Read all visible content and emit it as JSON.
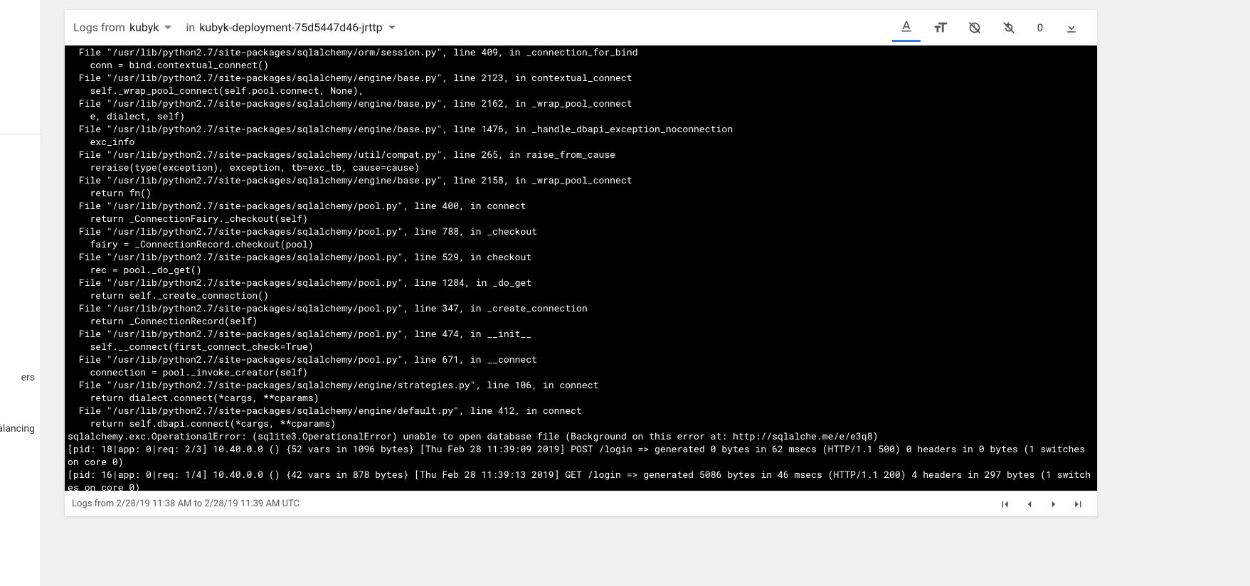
{
  "sidebar": {
    "items": [
      "ers",
      "alancing"
    ]
  },
  "header": {
    "selector1_label": "Logs from",
    "selector1_value": "kubyk",
    "selector2_label": "in",
    "selector2_value": "kubyk-deployment-75d5447d46-jrttp",
    "count": "0"
  },
  "log_lines": [
    "  File \"/usr/lib/python2.7/site-packages/sqlalchemy/orm/session.py\", line 409, in _connection_for_bind",
    "    conn = bind.contextual_connect()",
    "  File \"/usr/lib/python2.7/site-packages/sqlalchemy/engine/base.py\", line 2123, in contextual_connect",
    "    self._wrap_pool_connect(self.pool.connect, None),",
    "  File \"/usr/lib/python2.7/site-packages/sqlalchemy/engine/base.py\", line 2162, in _wrap_pool_connect",
    "    e, dialect, self)",
    "  File \"/usr/lib/python2.7/site-packages/sqlalchemy/engine/base.py\", line 1476, in _handle_dbapi_exception_noconnection",
    "    exc_info",
    "  File \"/usr/lib/python2.7/site-packages/sqlalchemy/util/compat.py\", line 265, in raise_from_cause",
    "    reraise(type(exception), exception, tb=exc_tb, cause=cause)",
    "  File \"/usr/lib/python2.7/site-packages/sqlalchemy/engine/base.py\", line 2158, in _wrap_pool_connect",
    "    return fn()",
    "  File \"/usr/lib/python2.7/site-packages/sqlalchemy/pool.py\", line 400, in connect",
    "    return _ConnectionFairy._checkout(self)",
    "  File \"/usr/lib/python2.7/site-packages/sqlalchemy/pool.py\", line 788, in _checkout",
    "    fairy = _ConnectionRecord.checkout(pool)",
    "  File \"/usr/lib/python2.7/site-packages/sqlalchemy/pool.py\", line 529, in checkout",
    "    rec = pool._do_get()",
    "  File \"/usr/lib/python2.7/site-packages/sqlalchemy/pool.py\", line 1284, in _do_get",
    "    return self._create_connection()",
    "  File \"/usr/lib/python2.7/site-packages/sqlalchemy/pool.py\", line 347, in _create_connection",
    "    return _ConnectionRecord(self)",
    "  File \"/usr/lib/python2.7/site-packages/sqlalchemy/pool.py\", line 474, in __init__",
    "    self.__connect(first_connect_check=True)",
    "  File \"/usr/lib/python2.7/site-packages/sqlalchemy/pool.py\", line 671, in __connect",
    "    connection = pool._invoke_creator(self)",
    "  File \"/usr/lib/python2.7/site-packages/sqlalchemy/engine/strategies.py\", line 106, in connect",
    "    return dialect.connect(*cargs, **cparams)",
    "  File \"/usr/lib/python2.7/site-packages/sqlalchemy/engine/default.py\", line 412, in connect",
    "    return self.dbapi.connect(*cargs, **cparams)",
    "sqlalchemy.exc.OperationalError: (sqlite3.OperationalError) unable to open database file (Background on this error at: http://sqlalche.me/e/e3q8)",
    "[pid: 18|app: 0|req: 2/3] 10.40.0.0 () {52 vars in 1096 bytes} [Thu Feb 28 11:39:09 2019] POST /login => generated 0 bytes in 62 msecs (HTTP/1.1 500) 0 headers in 0 bytes (1 switches on core 0)",
    "[pid: 16|app: 0|req: 1/4] 10.40.0.0 () {42 vars in 878 bytes} [Thu Feb 28 11:39:13 2019] GET /login => generated 5086 bytes in 46 msecs (HTTP/1.1 200) 4 headers in 297 bytes (1 switches on core 0)"
  ],
  "footer": {
    "range_text": "Logs from 2/28/19 11:38 AM to 2/28/19 11:39 AM UTC"
  }
}
